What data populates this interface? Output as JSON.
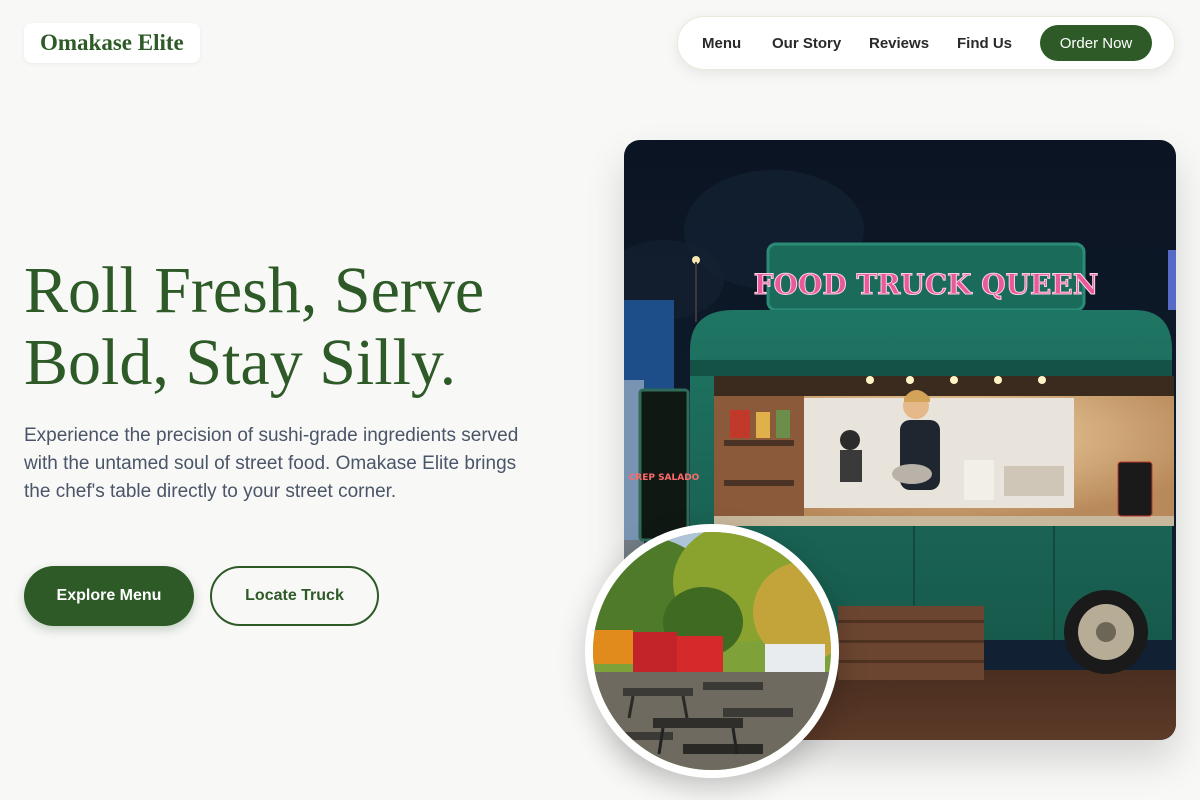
{
  "brand": {
    "name": "Omakase Elite"
  },
  "nav": {
    "links": [
      "Menu",
      "Our Story",
      "Reviews",
      "Find Us"
    ],
    "cta_label": "Order Now"
  },
  "hero": {
    "headline_line1": "Roll Fresh, Serve",
    "headline_line2": "Bold, Stay Silly.",
    "lede": "Experience the precision of sushi-grade ingredients served with the untamed soul of street food. Omakase Elite brings the chef's table directly to your street corner.",
    "primary_button": "Explore Menu",
    "secondary_button": "Locate Truck"
  },
  "photos": {
    "truck_sign": "FOOD TRUCK QUEEN",
    "side_board": "CREP SALADO"
  },
  "colors": {
    "brand_green": "#2d5a27",
    "background": "#f8f8f7",
    "body_text": "#4a5568"
  }
}
